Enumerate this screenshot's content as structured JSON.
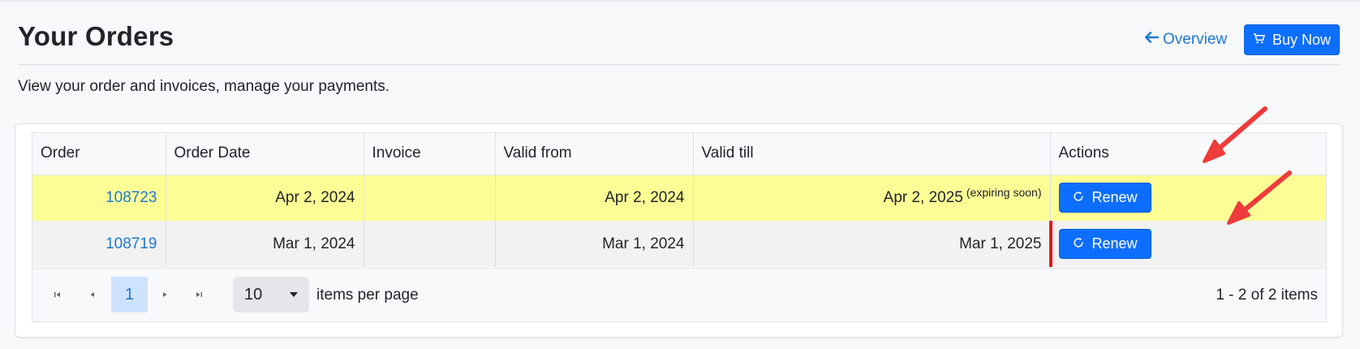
{
  "header": {
    "title": "Your Orders",
    "overview_label": "Overview",
    "buy_label": "Buy Now",
    "subtitle": "View your order and invoices, manage your payments."
  },
  "table": {
    "columns": [
      "Order",
      "Order Date",
      "Invoice",
      "Valid from",
      "Valid till",
      "Actions"
    ],
    "rows": [
      {
        "order": "108723",
        "order_date": "Apr 2, 2024",
        "invoice": "",
        "valid_from": "Apr 2, 2024",
        "valid_till": "Apr 2, 2025",
        "note": "(expiring soon)",
        "action": "Renew"
      },
      {
        "order": "108719",
        "order_date": "Mar 1, 2024",
        "invoice": "",
        "valid_from": "Mar 1, 2024",
        "valid_till": "Mar 1, 2025",
        "note": "",
        "action": "Renew"
      }
    ]
  },
  "pager": {
    "current_page": "1",
    "page_size": "10",
    "per_page_label": "items per page",
    "info": "1 - 2 of 2 items"
  },
  "colors": {
    "accent": "#0d6efd",
    "link": "#1f78d1",
    "expiring_row": "#fdfd96",
    "annotation": "#ee3b3b"
  },
  "icons": {
    "overview": "arrow-left-icon",
    "buy": "cart-icon",
    "renew": "refresh-icon",
    "pager": [
      "first-page-icon",
      "prev-page-icon",
      "next-page-icon",
      "last-page-icon"
    ]
  }
}
